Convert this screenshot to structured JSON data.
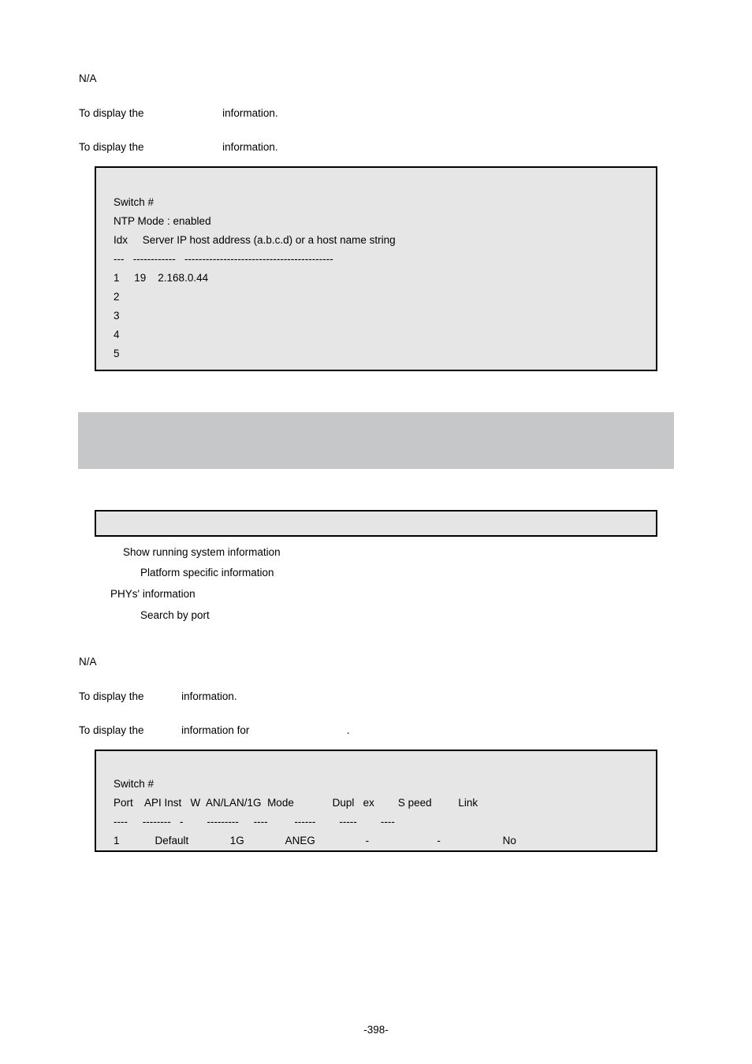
{
  "top": {
    "na": "N/A",
    "display1_pre": "To display the",
    "display1_post": "information.",
    "display2_pre": "To display the",
    "display2_post": "information."
  },
  "code1": {
    "l1": "Switch #",
    "l2": "NTP Mode : enabled",
    "l3": "Idx     Server IP host address (a.b.c.d) or a host name string",
    "l4": "---   ------------   ------------------------------------------",
    "l5": "1     19    2.168.0.44",
    "l6": "2",
    "l7": "3",
    "l8": "4",
    "l9": "5"
  },
  "mid": {
    "r1": "Show running system information",
    "r2": "Platform specific information",
    "r3": "PHYs' information",
    "r4": "Search by port",
    "na": "N/A",
    "d1_pre": "To display the",
    "d1_post": "information.",
    "d2_pre": "To display the",
    "d2_mid": "information for",
    "d2_post": "."
  },
  "code2": {
    "l1": "Switch #",
    "l2": "Port    API Inst   W  AN/LAN/1G  Mode             Dupl   ex        S peed         Link",
    "l3": "----     --------   -        ---------     ----         ------        -----        ----",
    "l4": "1            Default              1G              ANEG                 -                       -                     No"
  },
  "footer": "-398-"
}
